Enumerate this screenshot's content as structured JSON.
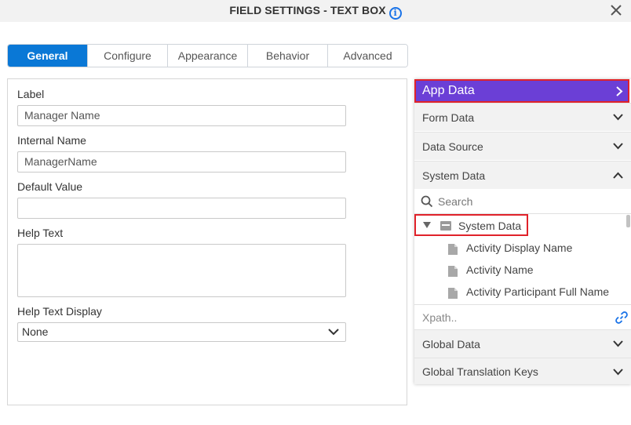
{
  "dialog": {
    "title": "FIELD SETTINGS - TEXT BOX",
    "info_icon": "info-icon",
    "close_icon": "close-icon"
  },
  "tabs": [
    {
      "label": "General",
      "active": true
    },
    {
      "label": "Configure",
      "active": false
    },
    {
      "label": "Appearance",
      "active": false
    },
    {
      "label": "Behavior",
      "active": false
    },
    {
      "label": "Advanced",
      "active": false
    }
  ],
  "form": {
    "label_label": "Label",
    "label_value": "Manager Name",
    "internal_name_label": "Internal Name",
    "internal_name_value": "ManagerName",
    "default_value_label": "Default Value",
    "default_value_value": "",
    "help_text_label": "Help Text",
    "help_text_value": "",
    "help_text_display_label": "Help Text Display",
    "help_text_display_value": "None"
  },
  "data_panel": {
    "app_data": "App Data",
    "form_data": "Form Data",
    "data_source": "Data Source",
    "system_data": "System Data",
    "search_placeholder": "Search",
    "tree_root": "System Data",
    "tree_items": [
      "Activity Display Name",
      "Activity Name",
      "Activity Participant Full Name"
    ],
    "xpath_placeholder": "Xpath..",
    "global_data": "Global Data",
    "global_translation_keys": "Global Translation Keys"
  },
  "colors": {
    "tab_active": "#0a78d6",
    "app_data_bg": "#6b3fd6",
    "highlight_border": "#e0222a",
    "info_blue": "#1a73e8"
  }
}
